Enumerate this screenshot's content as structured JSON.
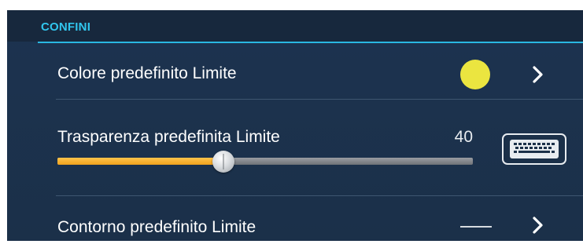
{
  "section": {
    "title": "CONFINI"
  },
  "rows": {
    "color": {
      "label": "Colore predefinito Limite",
      "swatch_color": "#ebe540",
      "action_icon": "chevron-right-icon"
    },
    "transparency": {
      "label": "Trasparenza predefinita Limite",
      "value": "40",
      "slider_percent": 40,
      "slider_fill_color": "#f5a623",
      "action_icon": "keyboard-icon"
    },
    "outline": {
      "label": "Contorno predefinito Limite",
      "line_style": "solid",
      "action_icon": "chevron-right-icon"
    }
  },
  "colors": {
    "accent": "#31c6ee",
    "panel_background": "#1c3350",
    "header_background": "#17283d",
    "divider": "#3e5670"
  }
}
